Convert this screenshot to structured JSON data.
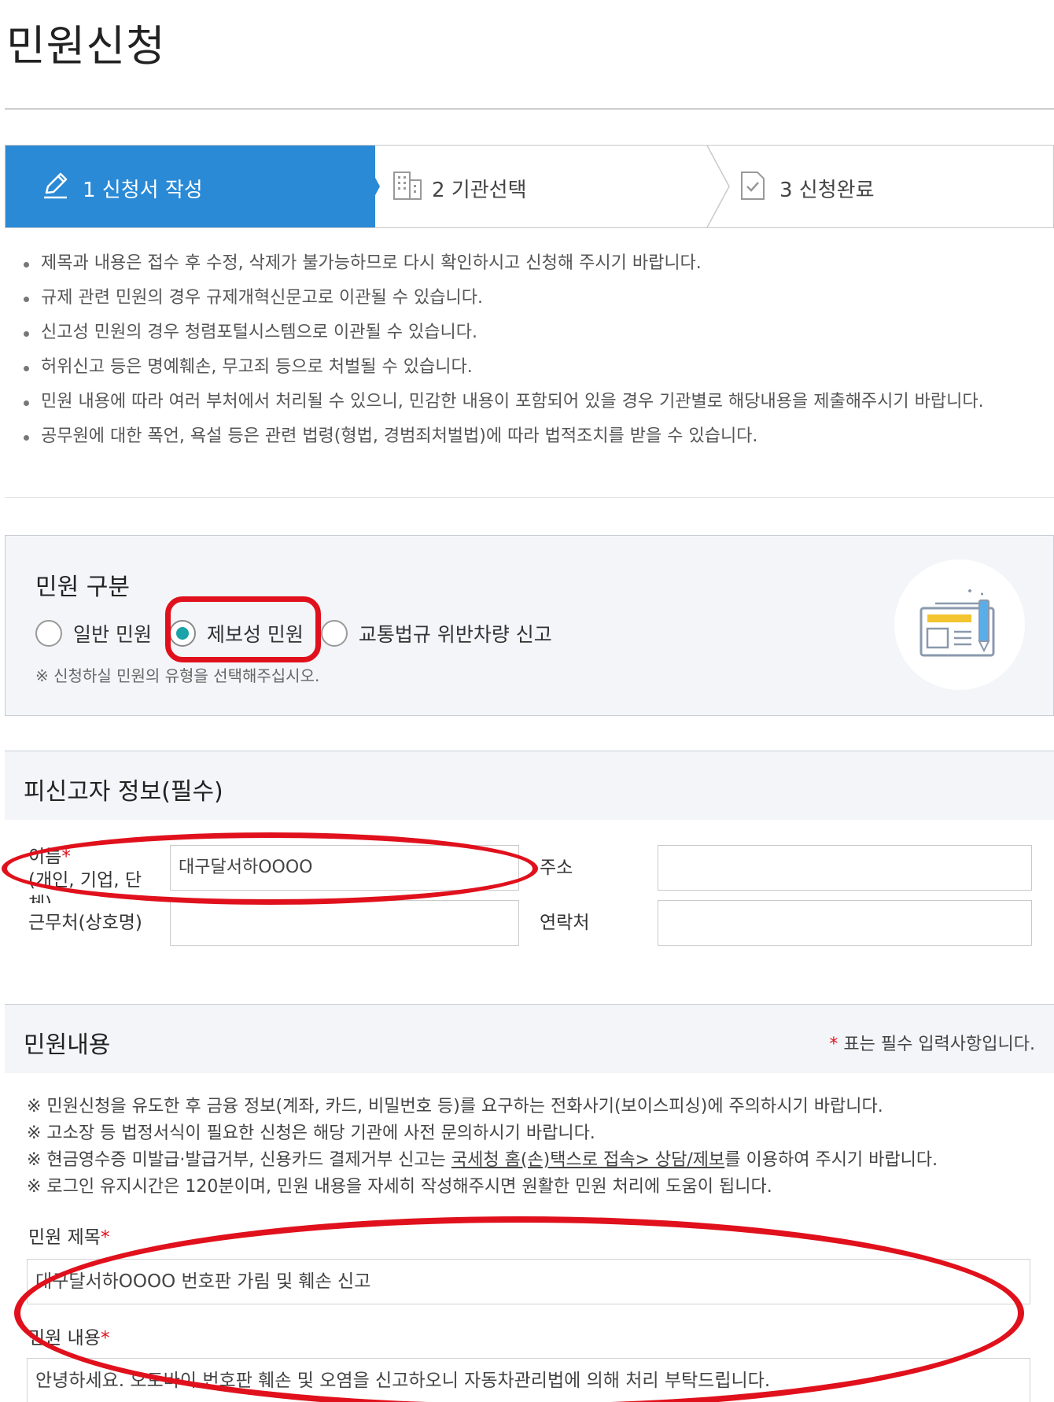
{
  "page": {
    "title": "민원신청"
  },
  "steps": [
    {
      "label": "1 신청서 작성",
      "icon": "pencil-icon",
      "active": true
    },
    {
      "label": "2 기관선택",
      "icon": "building-icon",
      "active": false
    },
    {
      "label": "3 신청완료",
      "icon": "document-check-icon",
      "active": false
    }
  ],
  "notices": [
    "제목과 내용은 접수 후 수정, 삭제가 불가능하므로 다시 확인하시고 신청해 주시기 바랍니다.",
    "규제 관련 민원의 경우 규제개혁신문고로 이관될 수 있습니다.",
    "신고성 민원의 경우 청렴포털시스템으로 이관될 수 있습니다.",
    "허위신고 등은 명예훼손, 무고죄 등으로 처벌될 수 있습니다.",
    "민원 내용에 따라 여러 부처에서 처리될 수 있으니, 민감한 내용이 포함되어 있을 경우 기관별로 해당내용을 제출해주시기 바랍니다.",
    "공무원에 대한 폭언, 욕설 등은 관련 법령(형법, 경범죄처벌법)에 따라 법적조치를 받을 수 있습니다."
  ],
  "complaint_type": {
    "title": "민원 구분",
    "options": [
      {
        "label": "일반 민원",
        "selected": false
      },
      {
        "label": "제보성 민원",
        "selected": true
      },
      {
        "label": "교통법규 위반차량 신고",
        "selected": false
      }
    ],
    "note": "※ 신청하실 민원의 유형을 선택해주십시오."
  },
  "respondent": {
    "title": "피신고자 정보(필수)",
    "name_label": "이름",
    "name_sub_label": "(개인, 기업, 단체)",
    "name_value": "대구달서하OOOO",
    "address_label": "주소",
    "address_value": "",
    "workplace_label": "근무처(상호명)",
    "workplace_value": "",
    "contact_label": "연락처",
    "contact_value": ""
  },
  "content": {
    "title": "민원내용",
    "required_note_star": "*",
    "required_note": " 표는 필수 입력사항입니다.",
    "warnings": [
      {
        "text": "※ 민원신청을 유도한 후 금융 정보(계좌, 카드, 비밀번호 등)를 요구하는 전화사기(보이스피싱)에 주의하시기 바랍니다."
      },
      {
        "text": "※ 고소장 등 법정서식이 필요한 신청은 해당 기관에 사전 문의하시기 바랍니다."
      },
      {
        "before": "※ 현금영수증 미발급·발급거부, 신용카드 결제거부 신고는 ",
        "link": "국세청 홈(손)택스로 접속> 상담/제보",
        "after": "를 이용하여 주시기 바랍니다."
      },
      {
        "text": "※ 로그인 유지시간은 120분이며, 민원 내용을 자세히 작성해주시면 원활한 민원 처리에 도움이 됩니다."
      }
    ],
    "subject_label": "민원 제목",
    "subject_value": "대구달서하OOOO 번호판 가림 및 훼손 신고",
    "body_label": "민원 내용",
    "body_value": "안녕하세요. 오토바이 번호판 훼손 및 오염을 신고하오니 자동차관리법에 의해 처리 부탁드립니다."
  },
  "colors": {
    "accent": "#2a8ad6",
    "radio_selected": "#1aa3a8",
    "highlight": "#e0111c",
    "panel_bg": "#f3f5f8"
  }
}
